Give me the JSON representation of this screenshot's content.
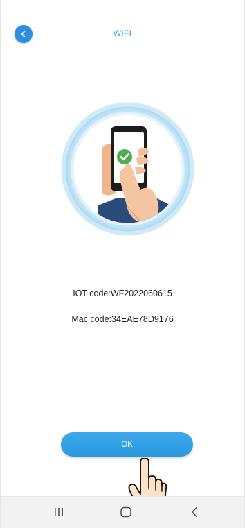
{
  "header": {
    "title": "WIFI",
    "back_icon": "chevron-left-icon"
  },
  "device": {
    "iot_code": "IOT code:WF2022060615",
    "mac_code": "Mac code:34EAE78D9176"
  },
  "actions": {
    "ok_label": "OK"
  },
  "nav": {
    "recents_icon": "recents-icon",
    "home_icon": "home-icon",
    "back_icon": "back-icon"
  },
  "colors": {
    "accent": "#2f9be6",
    "button": "#33a1e6",
    "text": "#222222"
  }
}
